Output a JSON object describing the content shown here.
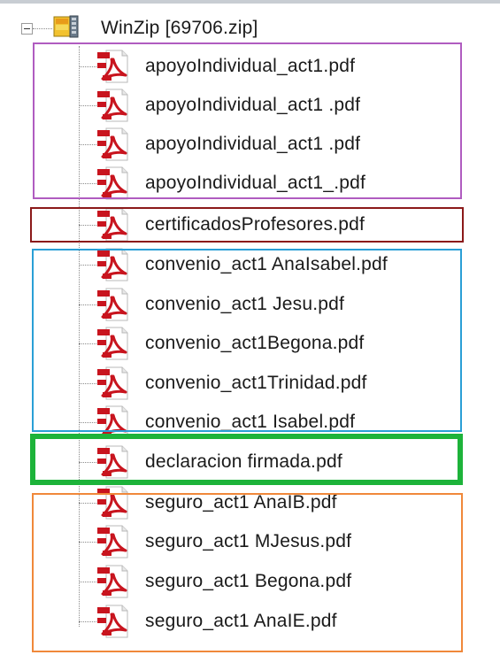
{
  "tree": {
    "root": {
      "label": "WinZip [69706.zip]",
      "icon": "winzip-archive-icon"
    },
    "files": [
      {
        "label": "apoyoIndividual_act1.pdf",
        "icon": "pdf-file-icon"
      },
      {
        "label": "apoyoIndividual_act1 .pdf",
        "icon": "pdf-file-icon"
      },
      {
        "label": "apoyoIndividual_act1 .pdf",
        "icon": "pdf-file-icon"
      },
      {
        "label": "apoyoIndividual_act1_.pdf",
        "icon": "pdf-file-icon"
      },
      {
        "label": "certificadosProfesores.pdf",
        "icon": "pdf-file-icon"
      },
      {
        "label": "convenio_act1 AnaIsabel.pdf",
        "icon": "pdf-file-icon"
      },
      {
        "label": "convenio_act1 Jesu.pdf",
        "icon": "pdf-file-icon"
      },
      {
        "label": "convenio_act1Begona.pdf",
        "icon": "pdf-file-icon"
      },
      {
        "label": "convenio_act1Trinidad.pdf",
        "icon": "pdf-file-icon"
      },
      {
        "label": "convenio_act1 Isabel.pdf",
        "icon": "pdf-file-icon"
      },
      {
        "label": "declaracion firmada.pdf",
        "icon": "pdf-file-icon"
      },
      {
        "label": "seguro_act1 AnaIB.pdf",
        "icon": "pdf-file-icon"
      },
      {
        "label": "seguro_act1 MJesus.pdf",
        "icon": "pdf-file-icon"
      },
      {
        "label": "seguro_act1 Begona.pdf",
        "icon": "pdf-file-icon"
      },
      {
        "label": "seguro_act1 AnaIE.pdf",
        "icon": "pdf-file-icon"
      }
    ]
  },
  "annotations": [
    {
      "name": "group-box-apoyo",
      "color": "#b05cc0"
    },
    {
      "name": "group-box-certificados",
      "color": "#8b1a1a"
    },
    {
      "name": "group-box-convenio",
      "color": "#2a9fd6"
    },
    {
      "name": "group-box-declaracion",
      "color": "#1db33a"
    },
    {
      "name": "group-box-seguro",
      "color": "#f0883a"
    }
  ]
}
